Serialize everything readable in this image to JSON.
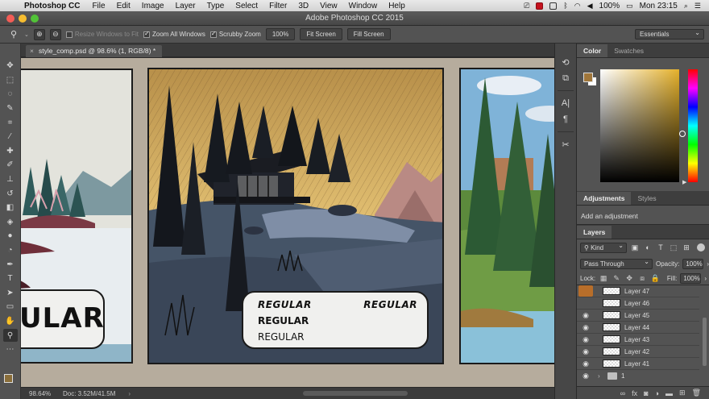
{
  "menubar": {
    "app_name": "Photoshop CC",
    "items": [
      "File",
      "Edit",
      "Image",
      "Layer",
      "Type",
      "Select",
      "Filter",
      "3D",
      "View",
      "Window",
      "Help"
    ],
    "battery": "100%",
    "clock": "Mon 23:15"
  },
  "window": {
    "title": "Adobe Photoshop CC 2015"
  },
  "options": {
    "resize_label": "Resize Windows to Fit",
    "zoom_all_label": "Zoom All Windows",
    "scrubby_label": "Scrubby Zoom",
    "zoom_value": "100%",
    "fit_screen": "Fit Screen",
    "fill_screen": "Fill Screen",
    "workspace": "Essentials"
  },
  "document": {
    "tab_label": "style_comp.psd @ 98.6% (1, RGB/8) *",
    "left_bubble": "ULAR",
    "bubble_line1": "REGULAR",
    "bubble_line2": "REGULAR",
    "bubble_line3": "REGULAR",
    "bubble_line4": "REGULAR"
  },
  "status": {
    "zoom": "98.64%",
    "doc": "Doc: 3.52M/41.5M"
  },
  "panels": {
    "color_tab": "Color",
    "swatches_tab": "Swatches",
    "adjustments_tab": "Adjustments",
    "styles_tab": "Styles",
    "add_adjustment": "Add an adjustment",
    "layers_tab": "Layers",
    "kind": "Kind",
    "blend_mode": "Pass Through",
    "opacity_label": "Opacity:",
    "opacity_value": "100%",
    "lock_label": "Lock:",
    "fill_label": "Fill:",
    "fill_value": "100%",
    "layers": [
      {
        "name": "Layer 47",
        "visible": false
      },
      {
        "name": "Layer 46",
        "visible": false
      },
      {
        "name": "Layer 45",
        "visible": true
      },
      {
        "name": "Layer 44",
        "visible": true
      },
      {
        "name": "Layer 43",
        "visible": true
      },
      {
        "name": "Layer 42",
        "visible": true
      },
      {
        "name": "Layer 41",
        "visible": true
      },
      {
        "name": "1",
        "visible": true,
        "folder": true
      }
    ]
  },
  "colors": {
    "foreground": "#a0763a",
    "background": "#ffffff"
  }
}
